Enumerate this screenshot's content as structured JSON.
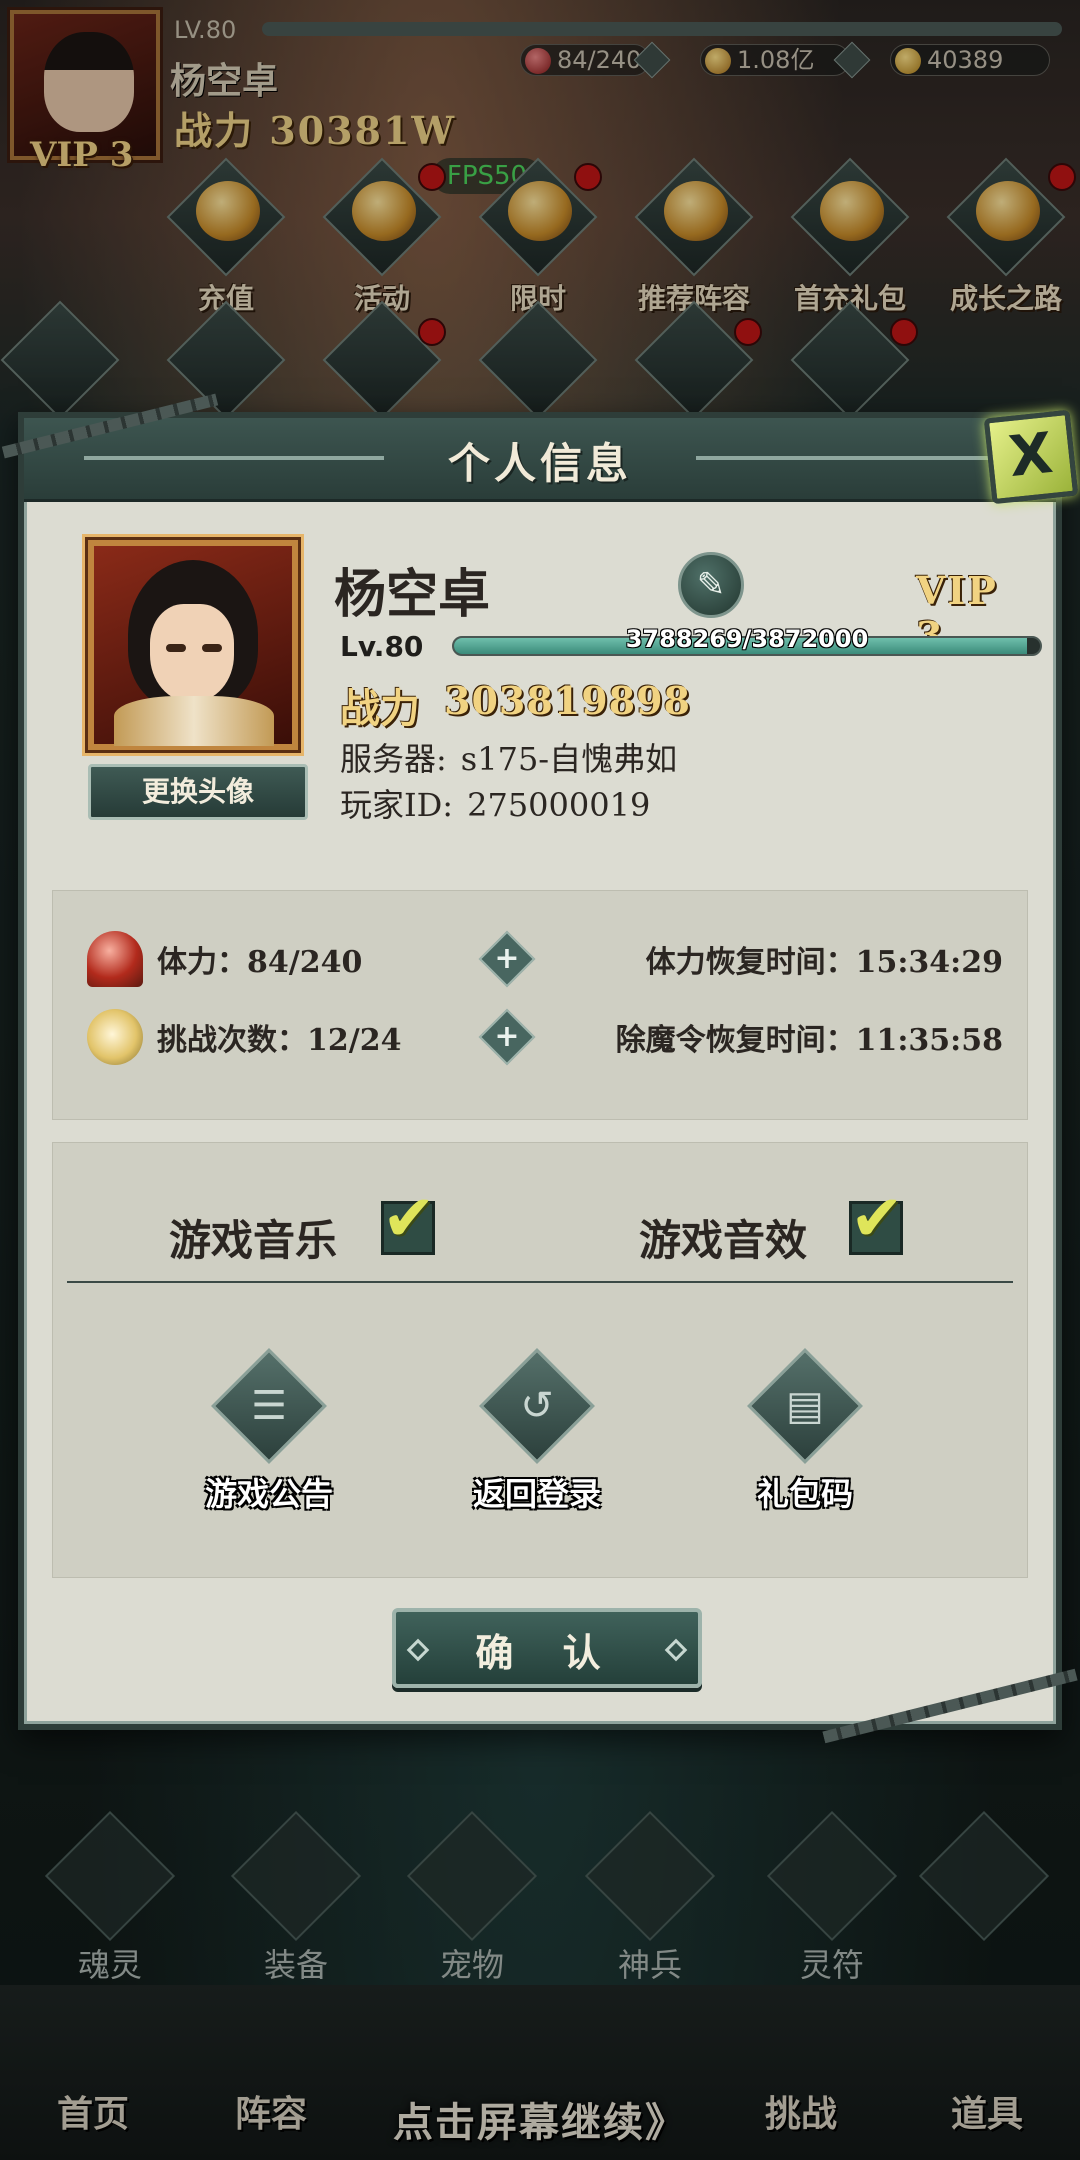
{
  "hud": {
    "level": "LV.80",
    "player_name": "杨空卓",
    "vip": "VIP 3",
    "power": "战力 30381W",
    "stamina": "84/240",
    "gold": "1.08亿",
    "ingots": "40389",
    "fps": "FPS50",
    "icons_row1": [
      "充值",
      "活动",
      "限时",
      "推荐阵容",
      "首充礼包",
      "成长之路"
    ],
    "bottom_icons": [
      "魂灵",
      "装备",
      "宠物",
      "神兵",
      "灵符"
    ],
    "nav": [
      "首页",
      "阵容",
      "挑战",
      "道具"
    ],
    "continue_hint": "点击屏幕继续》"
  },
  "modal": {
    "title": "个人信息",
    "close_label": "X",
    "profile": {
      "name": "杨空卓",
      "vip": "VIP 3",
      "level": "Lv.80",
      "exp": "3788269/3872000",
      "exp_fraction": 0.978,
      "power_label": "战力",
      "power_value": "303819898",
      "server_label": "服务器:",
      "server_value": "s175-自愧弗如",
      "id_label": "玩家ID:",
      "id_value": "275000019",
      "change_avatar": "更换头像"
    },
    "stats": [
      {
        "label": "体力：84/240",
        "time": "体力恢复时间：15:34:29"
      },
      {
        "label": "挑战次数：12/24",
        "time": "除魔令恢复时间：11:35:58"
      }
    ],
    "settings": {
      "music_label": "游戏音乐",
      "music_on": true,
      "sfx_label": "游戏音效",
      "sfx_on": true
    },
    "actions": [
      "游戏公告",
      "返回登录",
      "礼包码"
    ],
    "confirm": "确 认"
  },
  "colors": {
    "modal_bg": "#dcdcd2",
    "header_bg": "#2a3d39",
    "gold_text": "#f1d382",
    "checkbox_check": "#dfe55a"
  }
}
